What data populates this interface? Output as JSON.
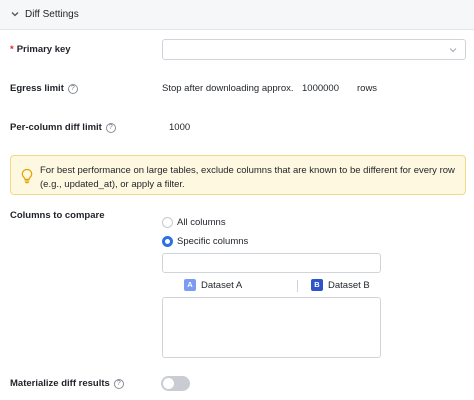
{
  "header": {
    "title": "Diff Settings",
    "icon": "chevron-down-icon"
  },
  "primary_key": {
    "required_mark": "*",
    "label": "Primary key",
    "value": ""
  },
  "egress_limit": {
    "label": "Egress limit",
    "prefix": "Stop after downloading approx.",
    "value": "1000000",
    "suffix": "rows"
  },
  "per_column_limit": {
    "label": "Per-column diff limit",
    "value": "1000"
  },
  "alert": {
    "icon": "lightbulb-icon",
    "text": "For best performance on large tables, exclude columns that are known to be different for every row (e.g., updated_at), or apply a filter."
  },
  "columns": {
    "label": "Columns to compare",
    "options": [
      {
        "label": "All columns",
        "selected": false
      },
      {
        "label": "Specific columns",
        "selected": true
      }
    ],
    "dataset_a": {
      "badge": "A",
      "label": "Dataset A",
      "color": "#7b9cf0"
    },
    "dataset_b": {
      "badge": "B",
      "label": "Dataset B",
      "color": "#2f54c9"
    }
  },
  "materialize": {
    "label": "Materialize diff results",
    "enabled": false
  },
  "help_glyph": "?",
  "colors": {
    "accent": "#2f6fe4",
    "required": "#d92d20",
    "alert_bg": "#fff8e1"
  }
}
